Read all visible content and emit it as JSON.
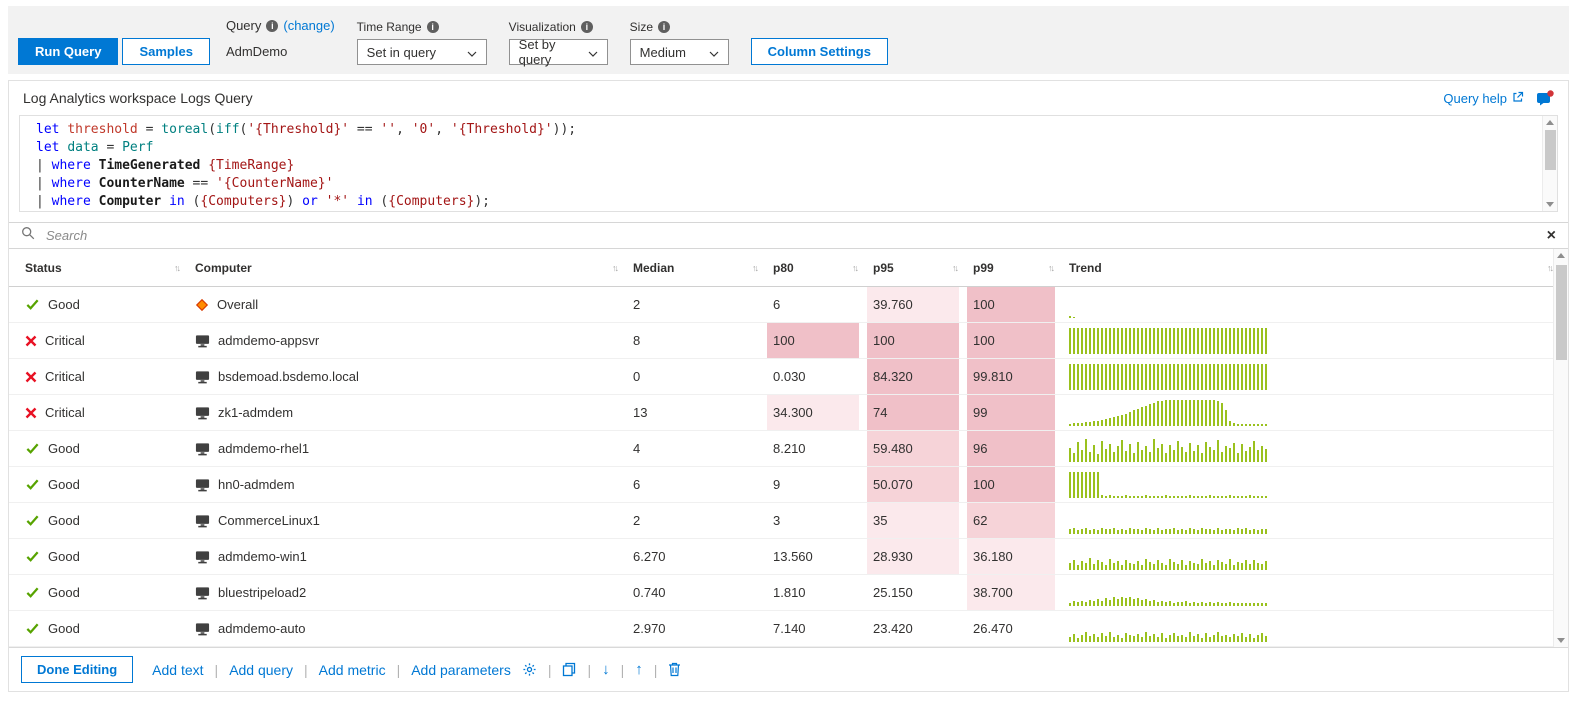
{
  "topbar": {
    "run_query": "Run Query",
    "samples": "Samples",
    "query": {
      "label": "Query",
      "change": "(change)",
      "value": "AdmDemo"
    },
    "time_range": {
      "label": "Time Range",
      "value": "Set in query"
    },
    "visualization": {
      "label": "Visualization",
      "value": "Set by query"
    },
    "size": {
      "label": "Size",
      "value": "Medium"
    },
    "column_settings": "Column Settings"
  },
  "query_panel": {
    "title": "Log Analytics workspace Logs Query",
    "help": "Query help",
    "code": [
      [
        [
          "kw",
          "let "
        ],
        [
          "var",
          "threshold"
        ],
        [
          "pl",
          " = "
        ],
        [
          "fn",
          "toreal"
        ],
        [
          "pl",
          "("
        ],
        [
          "fn",
          "iff"
        ],
        [
          "pl",
          "("
        ],
        [
          "str",
          "'{Threshold}'"
        ],
        [
          "pl",
          " == "
        ],
        [
          "str",
          "''"
        ],
        [
          "pl",
          ", "
        ],
        [
          "str",
          "'0'"
        ],
        [
          "pl",
          ", "
        ],
        [
          "str",
          "'{Threshold}'"
        ],
        [
          "pl",
          "));"
        ]
      ],
      [
        [
          "kw",
          "let "
        ],
        [
          "fn",
          "data"
        ],
        [
          "pl",
          " = "
        ],
        [
          "fn",
          "Perf"
        ]
      ],
      [
        [
          "pl",
          "| "
        ],
        [
          "kw",
          "where "
        ],
        [
          "col",
          "TimeGenerated"
        ],
        [
          "pl",
          " "
        ],
        [
          "str",
          "{TimeRange}"
        ]
      ],
      [
        [
          "pl",
          "| "
        ],
        [
          "kw",
          "where "
        ],
        [
          "col",
          "CounterName"
        ],
        [
          "pl",
          " == "
        ],
        [
          "str",
          "'{CounterName}'"
        ]
      ],
      [
        [
          "pl",
          "| "
        ],
        [
          "kw",
          "where "
        ],
        [
          "col",
          "Computer"
        ],
        [
          "pl",
          " "
        ],
        [
          "kw",
          "in"
        ],
        [
          "pl",
          " ("
        ],
        [
          "str",
          "{Computers}"
        ],
        [
          "pl",
          ") "
        ],
        [
          "kw",
          "or"
        ],
        [
          "pl",
          " "
        ],
        [
          "str",
          "'*'"
        ],
        [
          "pl",
          " "
        ],
        [
          "kw",
          "in"
        ],
        [
          "pl",
          " ("
        ],
        [
          "str",
          "{Computers}"
        ],
        [
          "pl",
          ");"
        ]
      ]
    ]
  },
  "search": {
    "placeholder": "Search"
  },
  "table": {
    "columns": [
      "Status",
      "Computer",
      "Median",
      "p80",
      "p95",
      "p99",
      "Trend"
    ],
    "rows": [
      {
        "status": "Good",
        "status_icon": "good",
        "computer_icon": "overall",
        "computer": "Overall",
        "median": {
          "v": "2",
          "h": 0
        },
        "p80": {
          "v": "6",
          "h": 0
        },
        "p95": {
          "v": "39.760",
          "h": 1
        },
        "p99": {
          "v": "100",
          "h": 3
        },
        "trend": [
          6,
          4
        ]
      },
      {
        "status": "Critical",
        "status_icon": "critical",
        "computer_icon": "computer",
        "computer": "admdemo-appsvr",
        "median": {
          "v": "8",
          "h": 0
        },
        "p80": {
          "v": "100",
          "h": 3
        },
        "p95": {
          "v": "100",
          "h": 3
        },
        "p99": {
          "v": "100",
          "h": 3
        },
        "trend": [
          100,
          100,
          100,
          100,
          100,
          100,
          100,
          100,
          100,
          100,
          100,
          100,
          100,
          100,
          100,
          100,
          100,
          100,
          100,
          100,
          100,
          100,
          100,
          100,
          100,
          100,
          100,
          100,
          100,
          100,
          100,
          100,
          100,
          100,
          100,
          100,
          100,
          100,
          100,
          100,
          100,
          100,
          100,
          100,
          100,
          100,
          100,
          100,
          100,
          100
        ]
      },
      {
        "status": "Critical",
        "status_icon": "critical",
        "computer_icon": "computer",
        "computer": "bsdemoad.bsdemo.local",
        "median": {
          "v": "0",
          "h": 0
        },
        "p80": {
          "v": "0.030",
          "h": 0
        },
        "p95": {
          "v": "84.320",
          "h": 3
        },
        "p99": {
          "v": "99.810",
          "h": 3
        },
        "trend": [
          100,
          100,
          100,
          100,
          100,
          100,
          100,
          100,
          100,
          100,
          100,
          100,
          100,
          100,
          100,
          100,
          100,
          100,
          100,
          100,
          100,
          100,
          100,
          100,
          100,
          100,
          100,
          100,
          100,
          100,
          100,
          100,
          100,
          100,
          100,
          100,
          100,
          100,
          100,
          100,
          100,
          100,
          100,
          100,
          100,
          100,
          100,
          100,
          100,
          100
        ]
      },
      {
        "status": "Critical",
        "status_icon": "critical",
        "computer_icon": "computer",
        "computer": "zk1-admdem",
        "median": {
          "v": "13",
          "h": 0
        },
        "p80": {
          "v": "34.300",
          "h": 1
        },
        "p95": {
          "v": "74",
          "h": 3
        },
        "p99": {
          "v": "99",
          "h": 3
        },
        "trend": [
          9,
          10,
          11,
          12,
          14,
          16,
          18,
          20,
          23,
          26,
          30,
          34,
          38,
          43,
          48,
          54,
          60,
          66,
          72,
          78,
          84,
          90,
          95,
          98,
          100,
          100,
          100,
          100,
          100,
          100,
          100,
          100,
          100,
          100,
          100,
          100,
          100,
          96,
          88,
          60,
          20,
          10,
          9,
          9,
          8,
          8,
          8,
          8,
          8,
          8
        ]
      },
      {
        "status": "Good",
        "status_icon": "good",
        "computer_icon": "computer",
        "computer": "admdemo-rhel1",
        "median": {
          "v": "4",
          "h": 0
        },
        "p80": {
          "v": "8.210",
          "h": 0
        },
        "p95": {
          "v": "59.480",
          "h": 2
        },
        "p99": {
          "v": "96",
          "h": 3
        },
        "trend": [
          55,
          35,
          75,
          45,
          90,
          40,
          65,
          30,
          80,
          50,
          70,
          38,
          60,
          85,
          42,
          68,
          35,
          78,
          48,
          62,
          40,
          88,
          52,
          70,
          36,
          64,
          46,
          82,
          58,
          38,
          72,
          44,
          66,
          34,
          76,
          56,
          48,
          84,
          40,
          62,
          52,
          74,
          36,
          68,
          44,
          58,
          80,
          46,
          60,
          50
        ]
      },
      {
        "status": "Good",
        "status_icon": "good",
        "computer_icon": "computer",
        "computer": "hn0-admdem",
        "median": {
          "v": "6",
          "h": 0
        },
        "p80": {
          "v": "9",
          "h": 0
        },
        "p95": {
          "v": "50.070",
          "h": 2
        },
        "p99": {
          "v": "100",
          "h": 3
        },
        "trend": [
          100,
          100,
          100,
          100,
          100,
          100,
          100,
          100,
          12,
          8,
          10,
          7,
          9,
          8,
          10,
          7,
          8,
          9,
          7,
          10,
          8,
          7,
          9,
          8,
          10,
          7,
          8,
          9,
          7,
          8,
          10,
          7,
          9,
          8,
          7,
          10,
          8,
          9,
          7,
          8,
          10,
          7,
          9,
          8,
          7,
          10,
          8,
          9,
          7,
          8
        ]
      },
      {
        "status": "Good",
        "status_icon": "good",
        "computer_icon": "computer",
        "computer": "CommerceLinux1",
        "median": {
          "v": "2",
          "h": 0
        },
        "p80": {
          "v": "3",
          "h": 0
        },
        "p95": {
          "v": "35",
          "h": 1
        },
        "p99": {
          "v": "62",
          "h": 2
        },
        "trend": [
          18,
          22,
          16,
          20,
          24,
          17,
          21,
          15,
          23,
          19,
          18,
          22,
          16,
          20,
          17,
          24,
          18,
          21,
          15,
          22,
          19,
          17,
          23,
          16,
          20,
          18,
          22,
          15,
          21,
          17,
          24,
          19,
          16,
          22,
          18,
          20,
          15,
          23,
          17,
          21,
          19,
          16,
          22,
          18,
          24,
          15,
          20,
          17,
          21,
          19
        ]
      },
      {
        "status": "Good",
        "status_icon": "good",
        "computer_icon": "computer",
        "computer": "admdemo-win1",
        "median": {
          "v": "6.270",
          "h": 0
        },
        "p80": {
          "v": "13.560",
          "h": 0
        },
        "p95": {
          "v": "28.930",
          "h": 1
        },
        "p99": {
          "v": "36.180",
          "h": 1
        },
        "trend": [
          25,
          40,
          18,
          35,
          28,
          45,
          22,
          38,
          30,
          20,
          42,
          26,
          34,
          18,
          40,
          28,
          24,
          36,
          20,
          44,
          30,
          22,
          38,
          26,
          18,
          42,
          32,
          24,
          40,
          20,
          36,
          28,
          22,
          44,
          26,
          34,
          18,
          38,
          30,
          24,
          42,
          20,
          32,
          26,
          38,
          22,
          40,
          28,
          24,
          34
        ]
      },
      {
        "status": "Good",
        "status_icon": "good",
        "computer_icon": "computer",
        "computer": "bluestripeload2",
        "median": {
          "v": "0.740",
          "h": 0
        },
        "p80": {
          "v": "1.810",
          "h": 0
        },
        "p95": {
          "v": "25.150",
          "h": 0
        },
        "p99": {
          "v": "38.700",
          "h": 1
        },
        "trend": [
          12,
          18,
          14,
          20,
          16,
          22,
          18,
          26,
          20,
          30,
          24,
          34,
          28,
          36,
          30,
          34,
          26,
          30,
          22,
          26,
          18,
          22,
          16,
          20,
          14,
          18,
          12,
          16,
          14,
          18,
          12,
          16,
          10,
          14,
          12,
          16,
          10,
          14,
          12,
          10,
          14,
          10,
          12,
          10,
          12,
          10,
          12,
          10,
          12,
          10
        ]
      },
      {
        "status": "Good",
        "status_icon": "good",
        "computer_icon": "computer",
        "computer": "admdemo-auto",
        "median": {
          "v": "2.970",
          "h": 0
        },
        "p80": {
          "v": "7.140",
          "h": 0
        },
        "p95": {
          "v": "23.420",
          "h": 0
        },
        "p99": {
          "v": "26.470",
          "h": 0
        },
        "trend": [
          20,
          32,
          16,
          28,
          38,
          22,
          30,
          18,
          34,
          24,
          40,
          20,
          28,
          16,
          36,
          26,
          22,
          32,
          18,
          38,
          24,
          30,
          20,
          34,
          16,
          28,
          36,
          22,
          26,
          18,
          40,
          24,
          30,
          16,
          34,
          20,
          28,
          38,
          22,
          26,
          18,
          32,
          24,
          36,
          20,
          30,
          16,
          28,
          34,
          22
        ]
      }
    ]
  },
  "footer": {
    "done": "Done Editing",
    "links": [
      "Add text",
      "Add query",
      "Add metric",
      "Add parameters"
    ],
    "separator": "|"
  },
  "icons": {
    "sort_glyph": "↑↓",
    "clear_glyph": "×",
    "move_down_glyph": "↓",
    "move_up_glyph": "↑",
    "search": "magnifier",
    "info": "circled-i",
    "external_link": "box-arrow",
    "good": "green-check",
    "critical": "red-x",
    "computer": "monitor",
    "overall": "orange-diamond",
    "gear": "settings-gear",
    "copy": "overlapping-squares",
    "delete": "trash-can",
    "feedback": "chat-bubble-with-badge"
  },
  "colors": {
    "accent": "#0078d4",
    "good": "#57a300",
    "critical": "#e81123",
    "trend_bar": "#9ac11e",
    "heat_light": "#fbe9ec",
    "heat_medium": "#f6d3d8",
    "heat_strong": "#f0c0c8",
    "topbar_bg": "#f2f2f2"
  }
}
